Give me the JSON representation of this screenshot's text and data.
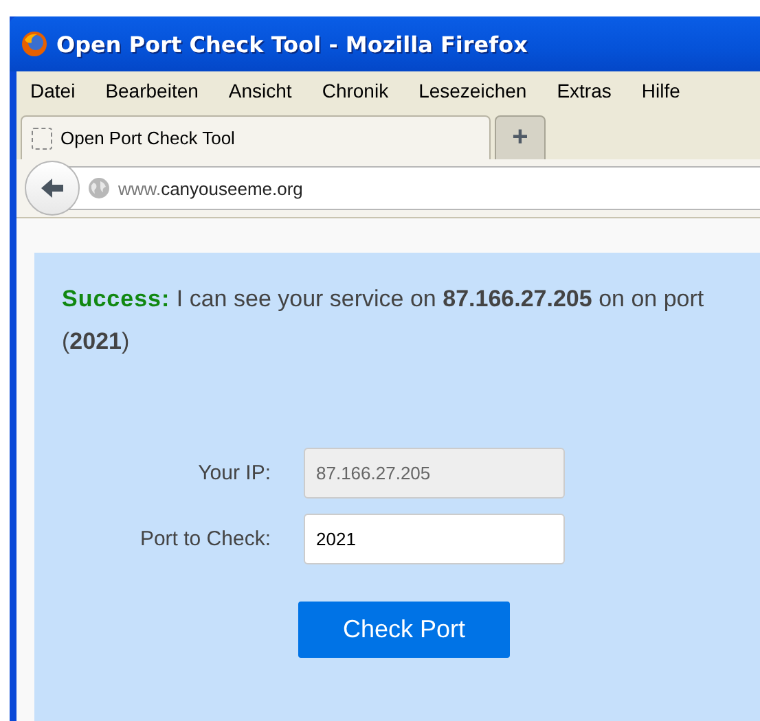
{
  "window": {
    "title": "Open Port Check Tool - Mozilla Firefox"
  },
  "menu": [
    "Datei",
    "Bearbeiten",
    "Ansicht",
    "Chronik",
    "Lesezeichen",
    "Extras",
    "Hilfe"
  ],
  "tabs": [
    {
      "label": "Open Port Check Tool",
      "selected": true
    }
  ],
  "new_tab": {
    "label": "+"
  },
  "address_bar": {
    "url_prefix": "www.",
    "url_domain": "canyouseeme.org"
  },
  "result": {
    "kind": "success",
    "status": "Success:",
    "message": "I can see your service on **87.166.27.205** on on port (**2021**)"
  },
  "form": {
    "fields": [
      {
        "label": "Your IP:",
        "value": "87.166.27.205",
        "disabled": true
      },
      {
        "label": "Port to Check:",
        "value": "2021",
        "disabled": false
      }
    ],
    "button": "Check Port"
  }
}
